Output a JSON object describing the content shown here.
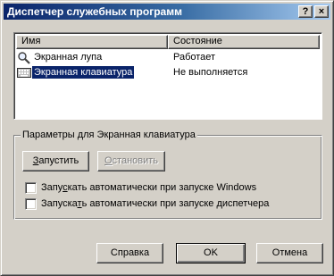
{
  "window": {
    "title": "Диспетчер служебных программ",
    "help_glyph": "?",
    "close_glyph": "×"
  },
  "list": {
    "columns": [
      "Имя",
      "Состояние"
    ],
    "rows": [
      {
        "name": "Экранная лупа",
        "status": "Работает",
        "icon": "magnifier-icon",
        "selected": false
      },
      {
        "name": "Экранная клавиатура",
        "status": "Не выполняется",
        "icon": "keyboard-icon",
        "selected": true
      }
    ]
  },
  "options": {
    "group_title": "Параметры для Экранная клавиатура",
    "start_label_u": "З",
    "start_label_rest": "апустить",
    "stop_label_u": "О",
    "stop_label_rest": "становить",
    "auto_windows_a": "Запу",
    "auto_windows_u": "с",
    "auto_windows_b": "кать автоматически при запуске Windows",
    "auto_windows_checked": false,
    "auto_manager_a": "Запуска",
    "auto_manager_u": "т",
    "auto_manager_b": "ь автоматически при запуске диспетчера",
    "auto_manager_checked": false
  },
  "footer": {
    "help": "Справка",
    "ok": "OK",
    "cancel": "Отмена"
  },
  "colors": {
    "face": "#d4d0c8",
    "title_active": "#0a246a",
    "selection": "#0a246a"
  }
}
